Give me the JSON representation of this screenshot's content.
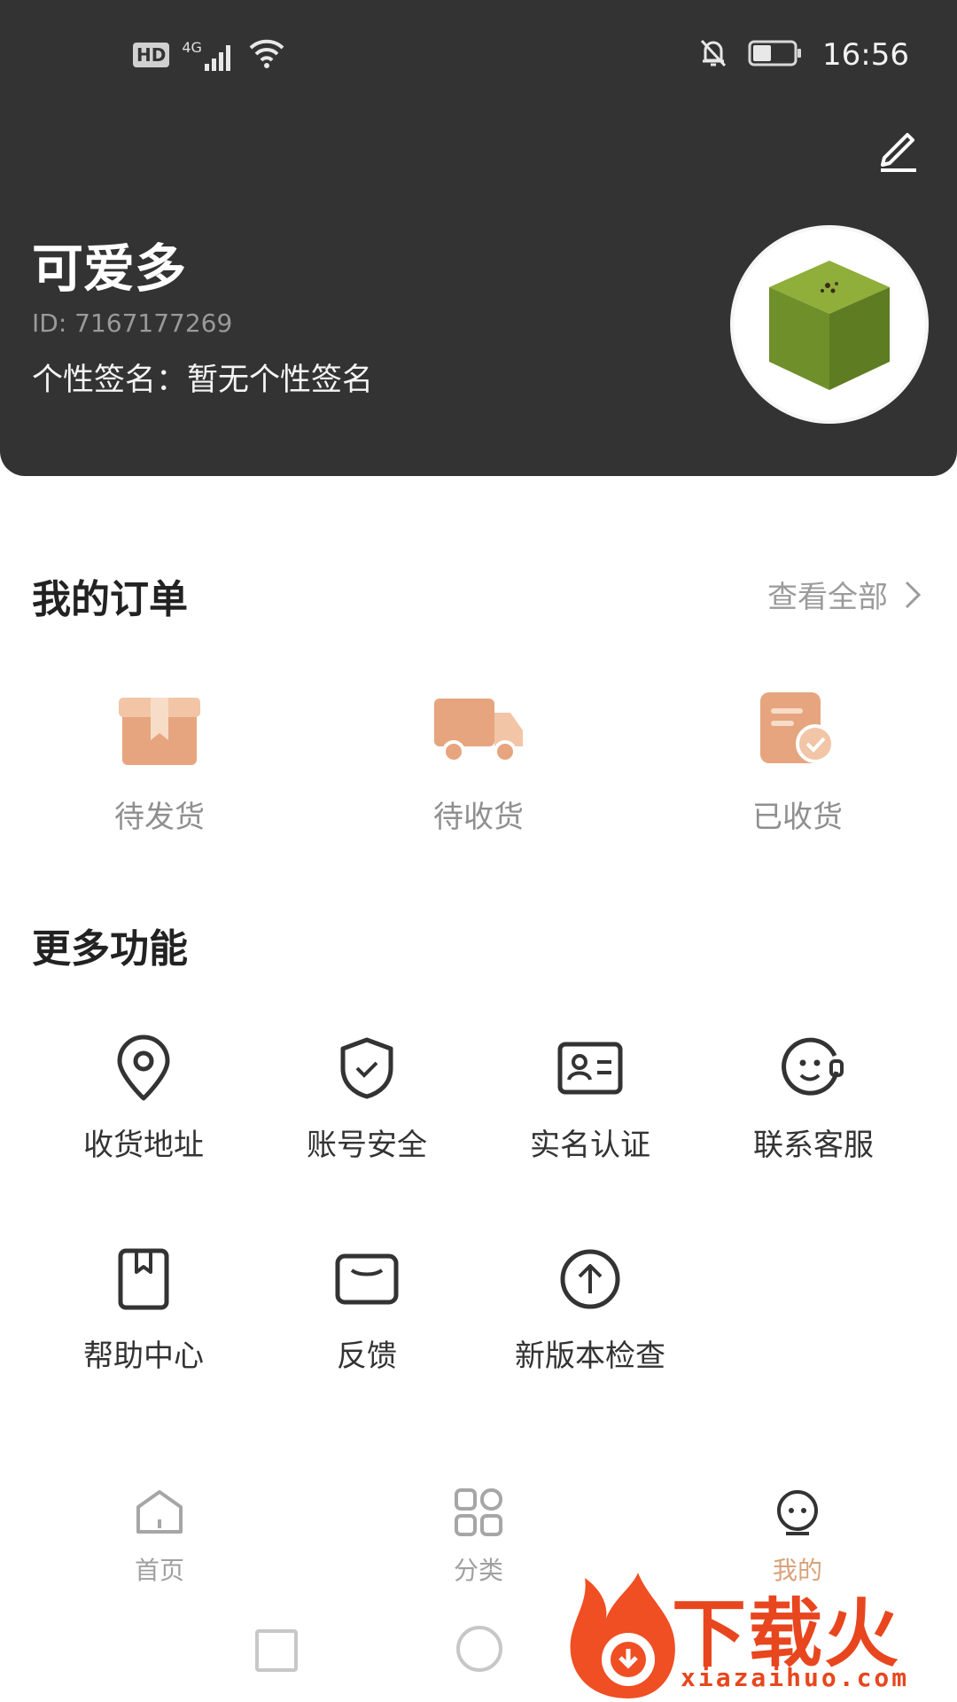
{
  "status_bar": {
    "network_hd": "HD",
    "network_type": "4G",
    "time": "16:56"
  },
  "profile": {
    "username": "可爱多",
    "user_id": "ID: 7167177269",
    "signature": "个性签名：暂无个性签名"
  },
  "orders": {
    "title": "我的订单",
    "view_all": "查看全部",
    "items": [
      {
        "label": "待发货",
        "icon": "package-box-icon"
      },
      {
        "label": "待收货",
        "icon": "delivery-truck-icon"
      },
      {
        "label": "已收货",
        "icon": "received-document-icon"
      }
    ]
  },
  "more": {
    "title": "更多功能",
    "items": [
      {
        "label": "收货地址",
        "icon": "location-pin-icon"
      },
      {
        "label": "账号安全",
        "icon": "shield-check-icon"
      },
      {
        "label": "实名认证",
        "icon": "id-card-icon"
      },
      {
        "label": "联系客服",
        "icon": "customer-service-icon"
      },
      {
        "label": "帮助中心",
        "icon": "help-book-icon"
      },
      {
        "label": "反馈",
        "icon": "feedback-mail-icon"
      },
      {
        "label": "新版本检查",
        "icon": "upgrade-arrow-icon"
      }
    ]
  },
  "tabbar": {
    "items": [
      {
        "label": "首页",
        "icon": "home-icon"
      },
      {
        "label": "分类",
        "icon": "category-grid-icon"
      },
      {
        "label": "我的",
        "icon": "profile-face-icon",
        "active": true
      }
    ]
  },
  "watermark": {
    "brand": "下载火",
    "url": "xiazaihuo.com"
  },
  "colors": {
    "header_bg": "#333333",
    "accent": "#d9a27a",
    "order_icon": "#e6a57e",
    "muted_text": "#9b9b9b"
  }
}
